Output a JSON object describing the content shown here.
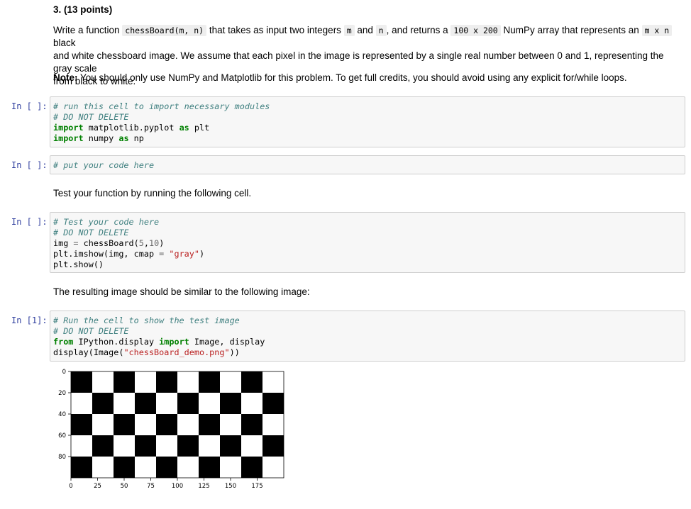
{
  "question": {
    "title": "3. (13 points)",
    "p1_a": "Write a function ",
    "p1_fn": "chessBoard(m, n)",
    "p1_b": " that takes as input two integers ",
    "p1_m": "m",
    "p1_c": " and ",
    "p1_n": "n",
    "p1_d": ", and returns a ",
    "p1_size": "100 x 200",
    "p1_e": " NumPy array that represents an ",
    "p1_mxn": "m x n",
    "p1_f": " black",
    "p1_line2": "and white chessboard image. We assume that each pixel in the image is represented by a single real number between 0 and 1, representing the gray scale",
    "p1_line3": "from black to white.",
    "note_label": "Note:",
    "note_text": " You should only use NumPy and Matplotlib for this problem. To get full credits, you should avoid using any explicit for/while loops.",
    "test_instruction": "Test your function by running the following cell.",
    "result_instruction": "The resulting image should be similar to the following image:"
  },
  "cells": {
    "c1": {
      "prompt": "In [ ]:",
      "l1": "# run this cell to import necessary modules",
      "l2": "# DO NOT DELETE",
      "l3_kw": "import",
      "l3_mod": " matplotlib.pyplot ",
      "l3_as": "as",
      "l3_alias": " plt",
      "l4_kw": "import",
      "l4_mod": " numpy ",
      "l4_as": "as",
      "l4_alias": " np"
    },
    "c2": {
      "prompt": "In [ ]:",
      "l1": "# put your code here"
    },
    "c3": {
      "prompt": "In [ ]:",
      "l1": "# Test your code here",
      "l2": "# DO NOT DELETE",
      "l3_a": "img ",
      "l3_eq": "=",
      "l3_b": " chessBoard(",
      "l3_n1": "5",
      "l3_c": ",",
      "l3_n2": "10",
      "l3_d": ")",
      "l4_a": "plt.imshow(img, cmap ",
      "l4_eq": "=",
      "l4_b": " ",
      "l4_str": "\"gray\"",
      "l4_c": ")",
      "l5": "plt.show()"
    },
    "c4": {
      "prompt": "In [1]:",
      "l1": "# Run the cell to show the test image",
      "l2": "# DO NOT DELETE",
      "l3_from": "from",
      "l3_mod": " IPython.display ",
      "l3_import": "import",
      "l3_rest": " Image, display",
      "l4_a": "display(Image(",
      "l4_str": "\"chessBoard_demo.png\"",
      "l4_b": "))"
    }
  },
  "chart_data": {
    "type": "heatmap",
    "title": "",
    "xlabel": "",
    "ylabel": "",
    "rows": 5,
    "cols": 10,
    "pattern": "alternating black and white squares, top-left square black",
    "xlim": [
      0,
      200
    ],
    "ylim": [
      100,
      0
    ],
    "x_ticks": [
      "0",
      "25",
      "50",
      "75",
      "100",
      "125",
      "150",
      "175"
    ],
    "y_ticks": [
      "0",
      "20",
      "40",
      "60",
      "80"
    ],
    "colormap": "gray",
    "colors": {
      "dark": "#000000",
      "light": "#ffffff"
    }
  }
}
